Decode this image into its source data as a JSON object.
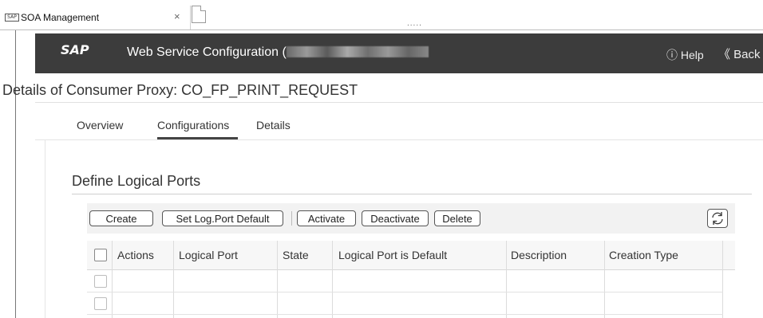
{
  "browser": {
    "tab_title": "SOA Management",
    "tab_favicon": "SAP",
    "close_glyph": "×",
    "drag_handle": "....."
  },
  "shell": {
    "logo": "SAP",
    "title_prefix": "Web Service Configuration (",
    "help_label": "ⓘ Help",
    "back_label": "《 Back"
  },
  "page": {
    "title": "Details of Consumer Proxy: CO_FP_PRINT_REQUEST",
    "tabs": [
      "Overview",
      "Configurations",
      "Details"
    ],
    "active_tab": "Configurations"
  },
  "section": {
    "title": "Define Logical Ports"
  },
  "toolbar": {
    "create": "Create",
    "set_default": "Set Log.Port Default",
    "activate": "Activate",
    "deactivate": "Deactivate",
    "delete": "Delete"
  },
  "table": {
    "columns": [
      "Actions",
      "Logical Port",
      "State",
      "Logical Port is Default",
      "Description",
      "Creation Type"
    ],
    "rows": [
      [],
      []
    ]
  },
  "icons": {
    "refresh": "refresh-icon",
    "help": "help-circle-icon",
    "back": "double-chevron-left-icon"
  }
}
